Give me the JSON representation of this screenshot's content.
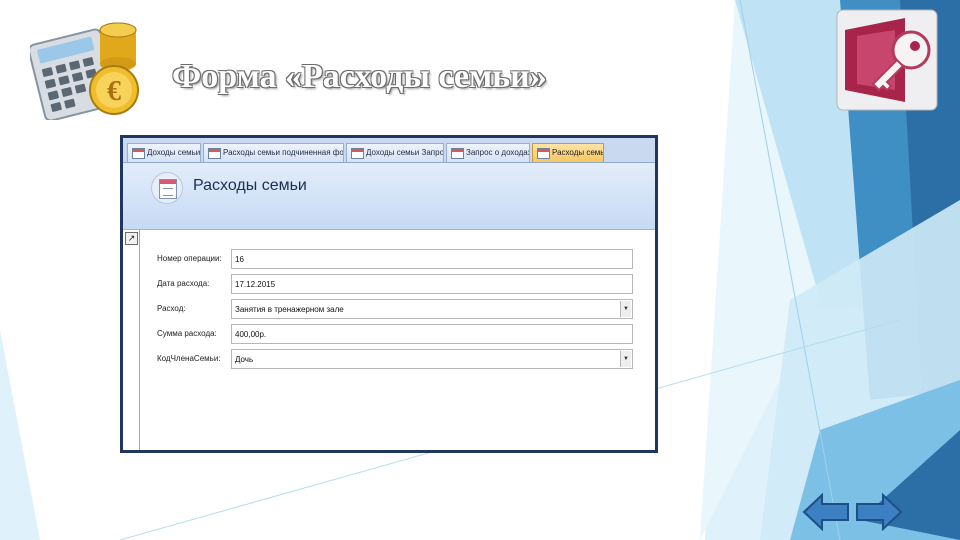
{
  "slide": {
    "title": "Форма «Расходы семьи»"
  },
  "access": {
    "tabs": [
      {
        "label": "Доходы семьи",
        "active": false
      },
      {
        "label": "Расходы семьи подчиненная форма",
        "active": false
      },
      {
        "label": "Доходы семьи Запрос",
        "active": false
      },
      {
        "label": "Запрос о доходах",
        "active": false
      },
      {
        "label": "Расходы семьи",
        "active": true
      }
    ],
    "form_title": "Расходы семьи",
    "fields": [
      {
        "label": "Номер операции:",
        "value": "16",
        "type": "text"
      },
      {
        "label": "Дата расхода:",
        "value": "17.12.2015",
        "type": "text"
      },
      {
        "label": "Расход:",
        "value": "Занятия в тренажерном зале",
        "type": "combo"
      },
      {
        "label": "Сумма расхода:",
        "value": "400,00р.",
        "type": "text"
      },
      {
        "label": "КодЧленаСемьи:",
        "value": "Дочь",
        "type": "combo"
      }
    ],
    "combo_arrow": "▼",
    "record_selector": "↗"
  },
  "icons": {
    "calculator": "calculator-coins-icon",
    "logo": "access-key-logo-icon",
    "prev": "arrow-left-icon",
    "next": "arrow-right-icon"
  },
  "colors": {
    "accent_dark": "#2c6fa6",
    "accent_light": "#9bd3ee",
    "arrow_fill": "#3c7fc2",
    "access_logo": "#a8244a"
  }
}
